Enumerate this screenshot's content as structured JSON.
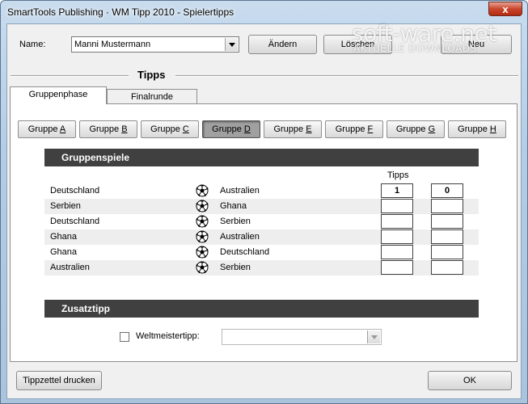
{
  "window": {
    "title": "SmartTools Publishing · WM Tipp 2010 - Spielertipps",
    "close_label": "x"
  },
  "player": {
    "name_label": "Name:",
    "name_value": "Manni Mustermann",
    "change_label": "Ändern",
    "delete_label": "Löschen",
    "new_label": "Neu"
  },
  "section_title": "Tipps",
  "tabs": [
    {
      "label": "Gruppenphase",
      "active": true
    },
    {
      "label": "Finalrunde",
      "active": false
    }
  ],
  "groups": [
    {
      "prefix": "Gruppe ",
      "letter": "A",
      "pressed": false
    },
    {
      "prefix": "Gruppe ",
      "letter": "B",
      "pressed": false
    },
    {
      "prefix": "Gruppe ",
      "letter": "C",
      "pressed": false
    },
    {
      "prefix": "Gruppe ",
      "letter": "D",
      "pressed": true
    },
    {
      "prefix": "Gruppe ",
      "letter": "E",
      "pressed": false
    },
    {
      "prefix": "Gruppe ",
      "letter": "F",
      "pressed": false
    },
    {
      "prefix": "Gruppe ",
      "letter": "G",
      "pressed": false
    },
    {
      "prefix": "Gruppe ",
      "letter": "H",
      "pressed": false
    }
  ],
  "group_games": {
    "header": "Gruppenspiele",
    "tips_label": "Tipps",
    "matches": [
      {
        "team1": "Deutschland",
        "team2": "Australien",
        "tip1": "1",
        "tip2": "0"
      },
      {
        "team1": "Serbien",
        "team2": "Ghana",
        "tip1": "",
        "tip2": ""
      },
      {
        "team1": "Deutschland",
        "team2": "Serbien",
        "tip1": "",
        "tip2": ""
      },
      {
        "team1": "Ghana",
        "team2": "Australien",
        "tip1": "",
        "tip2": ""
      },
      {
        "team1": "Ghana",
        "team2": "Deutschland",
        "tip1": "",
        "tip2": ""
      },
      {
        "team1": "Australien",
        "team2": "Serbien",
        "tip1": "",
        "tip2": ""
      }
    ]
  },
  "extra_tip": {
    "header": "Zusatztipp",
    "champion_label": "Weltmeistertipp:",
    "champion_checked": false,
    "champion_value": ""
  },
  "footer": {
    "print_label": "Tippzettel drucken",
    "ok_label": "OK"
  },
  "watermark": {
    "brand": "soft-ware.net",
    "sub": "AKTUELLE DOWNLOADS"
  },
  "icons": {
    "match": "soccer-ball-icon"
  }
}
